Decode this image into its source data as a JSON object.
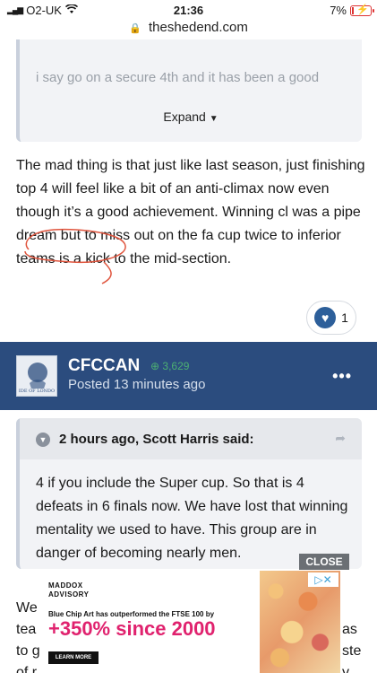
{
  "status_bar": {
    "carrier": "O2-UK",
    "time": "21:36",
    "battery": "7%",
    "battery_level": 0.07,
    "url": "theshedend.com"
  },
  "quote_top": {
    "faded_text": "i say go on a secure 4th and it has been a good",
    "expand_label": "Expand"
  },
  "post_body": "The mad thing is that just like last season, just finishing top 4 will feel like a bit of an anti-climax now even though it’s a good achievement. Winning cl was a pipe dream but to miss out on the fa cup twice to inferior teams is a kick to the mid-section.",
  "reaction": {
    "count": "1"
  },
  "author": {
    "username": "CFCCAN",
    "reputation": "3,629",
    "posted": "Posted 13 minutes ago",
    "avatar_text": "IDE OF LONDO"
  },
  "quote2": {
    "citation": "2 hours ago, Scott Harris said:",
    "text": "4 if you include the Super cup. So that is 4 defeats in 6 finals now. We have lost that winning mentality we used to have. This group are in danger of becoming nearly men."
  },
  "close_label": "CLOSE",
  "under_ad": {
    "left_lines": [
      "We",
      "tea",
      "to g",
      "of r"
    ],
    "right_lines": [
      "as",
      "ste",
      "y"
    ]
  },
  "ad": {
    "brand_line1": "MADDOX",
    "brand_line2": "ADVISORY",
    "tagline": "Blue Chip Art has outperformed the FTSE 100 by",
    "headline": "+350% since 2000",
    "cta": "LEARN MORE",
    "badge": "▷✕"
  }
}
